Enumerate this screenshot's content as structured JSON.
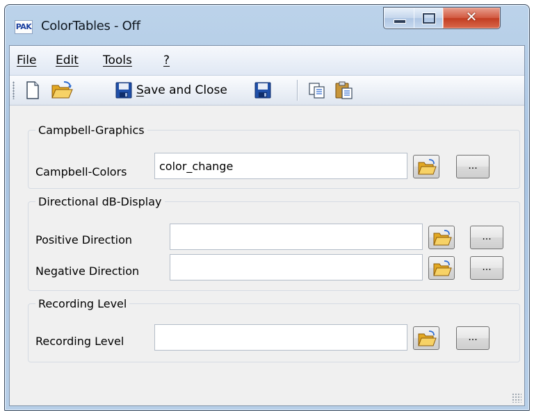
{
  "window": {
    "app_icon_text": "PAK",
    "title": "ColorTables - Off",
    "controls": {
      "minimize": "minimize",
      "maximize": "maximize",
      "close": "✕"
    }
  },
  "menu": {
    "items": [
      {
        "label": "File"
      },
      {
        "label": "Edit"
      },
      {
        "label": "Tools"
      },
      {
        "label": "?"
      }
    ]
  },
  "toolbar": {
    "save_and_close_label": "ave and Close",
    "save_and_close_mnemonic": "S",
    "icons": [
      "new-document-icon",
      "open-folder-icon",
      "save-icon",
      "save-icon",
      "copy-icon",
      "paste-icon"
    ]
  },
  "groups": {
    "campbell": {
      "legend": "Campbell-Graphics",
      "label": "Campbell-Colors",
      "value": "color_change"
    },
    "directional": {
      "legend": "Directional dB-Display",
      "positive_label": "Positive Direction",
      "positive_value": "",
      "negative_label": "Negative Direction",
      "negative_value": ""
    },
    "recording": {
      "legend": "Recording Level",
      "label": "Recording Level",
      "value": ""
    }
  },
  "browse_button_label": "...",
  "colors": {
    "titlebar": "#b4cce6",
    "client_bg": "#f0f0f0",
    "close_button": "#c8442a",
    "folder_yellow": "#f2c94c",
    "save_blue": "#1f4fa8"
  }
}
